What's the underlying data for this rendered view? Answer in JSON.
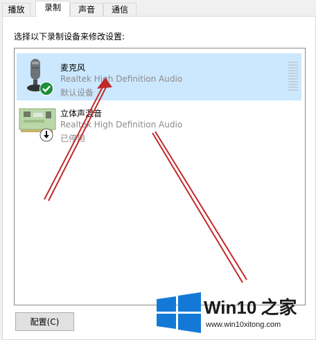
{
  "tabs": [
    {
      "label": "播放",
      "active": false
    },
    {
      "label": "录制",
      "active": true
    },
    {
      "label": "声音",
      "active": false
    },
    {
      "label": "通信",
      "active": false
    }
  ],
  "instruction": "选择以下录制设备来修改设置:",
  "devices": [
    {
      "name": "麦克风",
      "driver": "Realtek High Definition Audio",
      "status": "默认设备",
      "selected": true,
      "badge": "checkmark-icon",
      "icon": "microphone-icon"
    },
    {
      "name": "立体声混音",
      "driver": "Realtek High Definition Audio",
      "status": "已停用",
      "selected": false,
      "badge": "down-arrow-icon",
      "icon": "circuit-board-icon"
    }
  ],
  "configure_button": "配置(C)",
  "watermark": {
    "title": "Win10",
    "title_cn": "之家",
    "url": "www.win10xitong.com"
  },
  "colors": {
    "selection": "#cce8ff",
    "annotation_arrow": "#c0282a",
    "badge_green": "#1e8f3a",
    "logo_blue": "#1479d6"
  }
}
